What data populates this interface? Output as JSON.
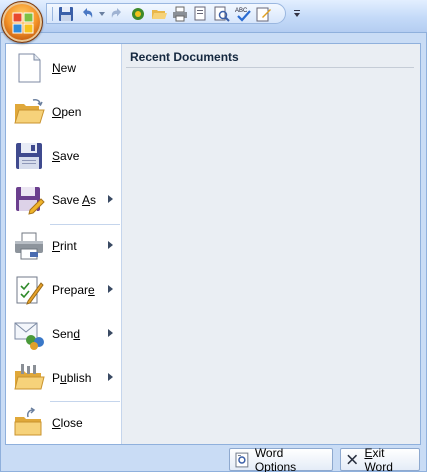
{
  "quick_access": {
    "items": [
      {
        "name": "save-icon"
      },
      {
        "name": "undo-icon"
      },
      {
        "name": "redo-icon"
      },
      {
        "name": "print-icon"
      },
      {
        "name": "open-icon"
      },
      {
        "name": "quick-print-icon"
      },
      {
        "name": "print-preview-icon"
      },
      {
        "name": "zoom-icon"
      },
      {
        "name": "spelling-icon"
      },
      {
        "name": "edit-icon"
      }
    ]
  },
  "menu": {
    "items": [
      {
        "id": "new",
        "label_pre": "",
        "label_u": "N",
        "label_post": "ew",
        "has_submenu": false
      },
      {
        "id": "open",
        "label_pre": "",
        "label_u": "O",
        "label_post": "pen",
        "has_submenu": false
      },
      {
        "id": "save",
        "label_pre": "",
        "label_u": "S",
        "label_post": "ave",
        "has_submenu": false
      },
      {
        "id": "save-as",
        "label_pre": "Save ",
        "label_u": "A",
        "label_post": "s",
        "has_submenu": true
      },
      {
        "id": "print",
        "label_pre": "",
        "label_u": "P",
        "label_post": "rint",
        "has_submenu": true
      },
      {
        "id": "prepare",
        "label_pre": "Prepar",
        "label_u": "e",
        "label_post": "",
        "has_submenu": true
      },
      {
        "id": "send",
        "label_pre": "Sen",
        "label_u": "d",
        "label_post": "",
        "has_submenu": true
      },
      {
        "id": "publish",
        "label_pre": "P",
        "label_u": "u",
        "label_post": "blish",
        "has_submenu": true
      },
      {
        "id": "close",
        "label_pre": "",
        "label_u": "C",
        "label_post": "lose",
        "has_submenu": false
      }
    ]
  },
  "recent": {
    "title": "Recent Documents"
  },
  "buttons": {
    "word_options_pre": "Word Opt",
    "word_options_u": "i",
    "word_options_post": "ons",
    "exit_word_pre": "",
    "exit_word_u": "E",
    "exit_word_post": "xit Word"
  },
  "colors": {
    "office_orange": "#f5952a",
    "frame_blue": "#c9dcf5",
    "recent_bg": "#eaeef3"
  }
}
